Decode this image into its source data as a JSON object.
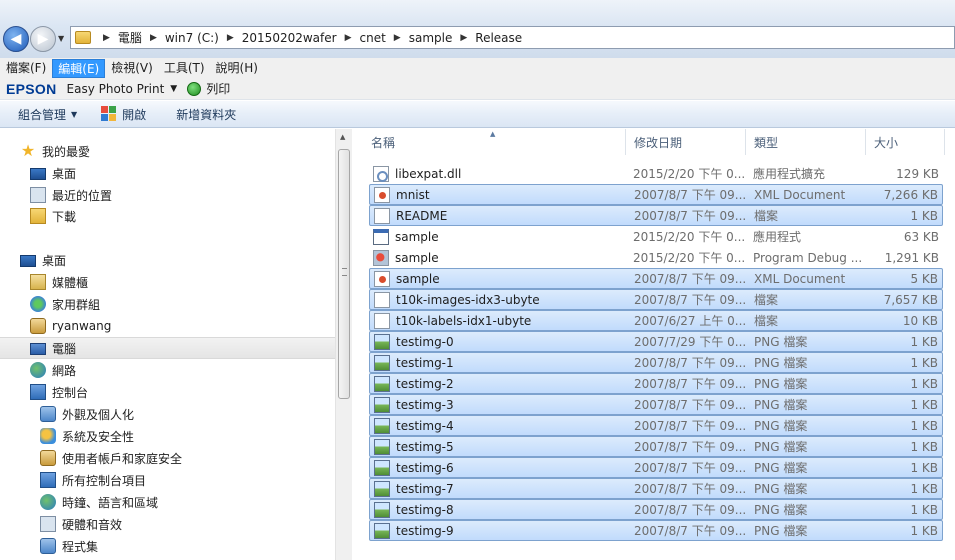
{
  "address": {
    "crumbs": [
      "電腦",
      "win7 (C:)",
      "20150202wafer",
      "cnet",
      "sample",
      "Release"
    ]
  },
  "menu": {
    "items": [
      "檔案(F)",
      "編輯(E)",
      "檢視(V)",
      "工具(T)",
      "說明(H)"
    ],
    "active_index": 1
  },
  "epson": {
    "logo": "EPSON",
    "app": "Easy Photo Print",
    "print_label": "列印"
  },
  "commands": {
    "organize": "組合管理",
    "open": "開啟",
    "new_folder": "新增資料夾"
  },
  "nav": {
    "favorites": "我的最愛",
    "fav_items": [
      "桌面",
      "最近的位置",
      "下載"
    ],
    "desktop": "桌面",
    "desktop_items": [
      "媒體櫃",
      "家用群組",
      "ryanwang",
      "電腦",
      "網路",
      "控制台"
    ],
    "cp_items": [
      "外觀及個人化",
      "系統及安全性",
      "使用者帳戶和家庭安全",
      "所有控制台項目",
      "時鐘、語言和區域",
      "硬體和音效",
      "程式集"
    ]
  },
  "columns": {
    "name": "名稱",
    "date": "修改日期",
    "type": "類型",
    "size": "大小"
  },
  "files": [
    {
      "name": "libexpat.dll",
      "date": "2015/2/20 下午 0...",
      "type": "應用程式擴充",
      "size": "129 KB",
      "icon": "dll-icon",
      "selected": false
    },
    {
      "name": "mnist",
      "date": "2007/8/7 下午 09...",
      "type": "XML Document",
      "size": "7,266 KB",
      "icon": "xml-icon",
      "selected": true
    },
    {
      "name": "README",
      "date": "2007/8/7 下午 09...",
      "type": "檔案",
      "size": "1 KB",
      "icon": "file-icon",
      "selected": true
    },
    {
      "name": "sample",
      "date": "2015/2/20 下午 0...",
      "type": "應用程式",
      "size": "63 KB",
      "icon": "exe-icon",
      "selected": false
    },
    {
      "name": "sample",
      "date": "2015/2/20 下午 0...",
      "type": "Program Debug ...",
      "size": "1,291 KB",
      "icon": "pdb-icon",
      "selected": false
    },
    {
      "name": "sample",
      "date": "2007/8/7 下午 09...",
      "type": "XML Document",
      "size": "5 KB",
      "icon": "xml-icon",
      "selected": true
    },
    {
      "name": "t10k-images-idx3-ubyte",
      "date": "2007/8/7 下午 09...",
      "type": "檔案",
      "size": "7,657 KB",
      "icon": "file-icon",
      "selected": true
    },
    {
      "name": "t10k-labels-idx1-ubyte",
      "date": "2007/6/27 上午 0...",
      "type": "檔案",
      "size": "10 KB",
      "icon": "file-icon",
      "selected": true
    },
    {
      "name": "testimg-0",
      "date": "2007/7/29 下午 0...",
      "type": "PNG 檔案",
      "size": "1 KB",
      "icon": "png-icon",
      "selected": true
    },
    {
      "name": "testimg-1",
      "date": "2007/8/7 下午 09...",
      "type": "PNG 檔案",
      "size": "1 KB",
      "icon": "png-icon",
      "selected": true
    },
    {
      "name": "testimg-2",
      "date": "2007/8/7 下午 09...",
      "type": "PNG 檔案",
      "size": "1 KB",
      "icon": "png-icon",
      "selected": true
    },
    {
      "name": "testimg-3",
      "date": "2007/8/7 下午 09...",
      "type": "PNG 檔案",
      "size": "1 KB",
      "icon": "png-icon",
      "selected": true
    },
    {
      "name": "testimg-4",
      "date": "2007/8/7 下午 09...",
      "type": "PNG 檔案",
      "size": "1 KB",
      "icon": "png-icon",
      "selected": true
    },
    {
      "name": "testimg-5",
      "date": "2007/8/7 下午 09...",
      "type": "PNG 檔案",
      "size": "1 KB",
      "icon": "png-icon",
      "selected": true
    },
    {
      "name": "testimg-6",
      "date": "2007/8/7 下午 09...",
      "type": "PNG 檔案",
      "size": "1 KB",
      "icon": "png-icon",
      "selected": true
    },
    {
      "name": "testimg-7",
      "date": "2007/8/7 下午 09...",
      "type": "PNG 檔案",
      "size": "1 KB",
      "icon": "png-icon",
      "selected": true
    },
    {
      "name": "testimg-8",
      "date": "2007/8/7 下午 09...",
      "type": "PNG 檔案",
      "size": "1 KB",
      "icon": "png-icon",
      "selected": true
    },
    {
      "name": "testimg-9",
      "date": "2007/8/7 下午 09...",
      "type": "PNG 檔案",
      "size": "1 KB",
      "icon": "png-icon",
      "selected": true
    }
  ]
}
